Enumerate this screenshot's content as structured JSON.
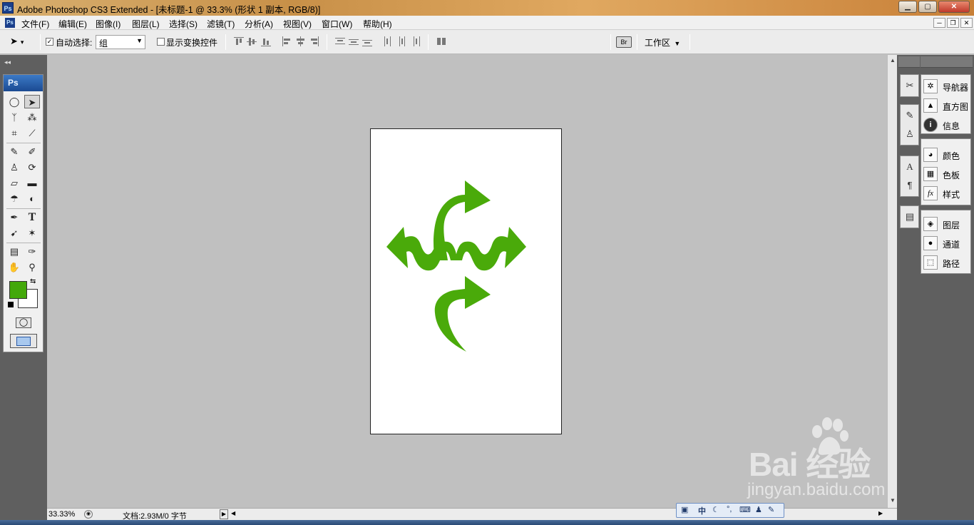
{
  "app": {
    "badge": "Ps",
    "title": "Adobe Photoshop CS3 Extended - [未标题-1 @ 33.3% (形状 1 副本, RGB/8)]"
  },
  "window_controls": {
    "minimize": "▁",
    "maximize": "▢",
    "close": "✕"
  },
  "mdi_controls": {
    "minimize": "─",
    "restore": "❐",
    "close": "✕"
  },
  "menu": {
    "items": [
      "文件(F)",
      "编辑(E)",
      "图像(I)",
      "图层(L)",
      "选择(S)",
      "滤镜(T)",
      "分析(A)",
      "视图(V)",
      "窗口(W)",
      "帮助(H)"
    ]
  },
  "options": {
    "auto_select_label": "自动选择:",
    "auto_select_checked": true,
    "auto_select_value": "组",
    "show_transform_label": "显示变换控件",
    "show_transform_checked": false,
    "workspace_label": "工作区"
  },
  "tools": {
    "header": "Ps",
    "foreground_color": "#43a80a",
    "background_color": "#ffffff"
  },
  "canvas": {
    "shape_color": "#4aaa0a",
    "document_bg": "#ffffff"
  },
  "status": {
    "zoom": "33.33%",
    "doc_info": "文档:2.93M/0 字节"
  },
  "panels": {
    "group1": [
      {
        "icon": "navigator-icon",
        "label": "导航器"
      },
      {
        "icon": "histogram-icon",
        "label": "直方图"
      },
      {
        "icon": "info-icon",
        "label": "信息"
      }
    ],
    "group2": [
      {
        "icon": "color-icon",
        "label": "颜色"
      },
      {
        "icon": "swatches-icon",
        "label": "色板"
      },
      {
        "icon": "styles-icon",
        "label": "样式"
      }
    ],
    "group3": [
      {
        "icon": "layers-icon",
        "label": "图层"
      },
      {
        "icon": "channels-icon",
        "label": "通道"
      },
      {
        "icon": "paths-icon",
        "label": "路径"
      }
    ]
  },
  "ime": {
    "mode": "中"
  },
  "watermark": {
    "brand": "Bai  经验",
    "url": "jingyan.baidu.com"
  }
}
